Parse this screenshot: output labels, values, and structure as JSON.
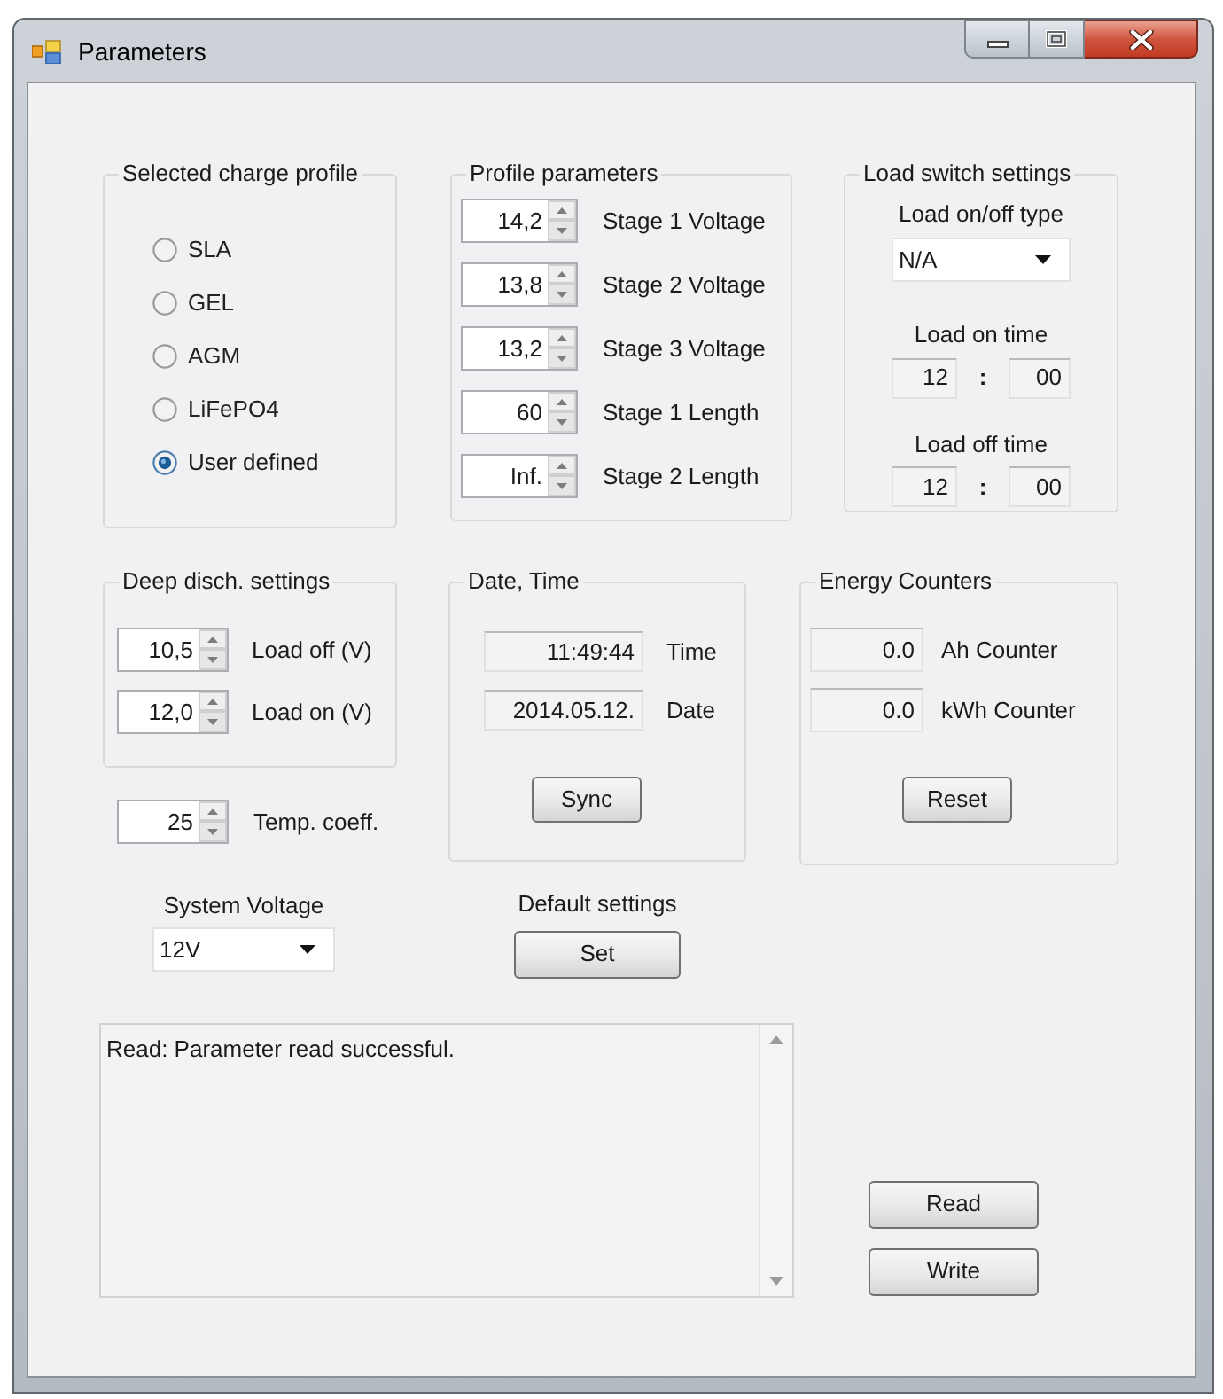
{
  "window": {
    "title": "Parameters"
  },
  "charge_profile": {
    "title": "Selected charge profile",
    "options": [
      {
        "label": "SLA",
        "selected": false
      },
      {
        "label": "GEL",
        "selected": false
      },
      {
        "label": "AGM",
        "selected": false
      },
      {
        "label": "LiFePO4",
        "selected": false
      },
      {
        "label": "User defined",
        "selected": true
      }
    ]
  },
  "profile_parameters": {
    "title": "Profile parameters",
    "rows": [
      {
        "value": "14,2",
        "label": "Stage 1 Voltage"
      },
      {
        "value": "13,8",
        "label": "Stage 2 Voltage"
      },
      {
        "value": "13,2",
        "label": "Stage 3 Voltage"
      },
      {
        "value": "60",
        "label": "Stage 1 Length"
      },
      {
        "value": "Inf.",
        "label": "Stage 2 Length"
      }
    ]
  },
  "load_switch": {
    "title": "Load switch settings",
    "type_label": "Load on/off type",
    "type_value": "N/A",
    "times": [
      {
        "label": "Load on time",
        "hours": "12",
        "separator": ":",
        "minutes": "00"
      },
      {
        "label": "Load off time",
        "hours": "12",
        "separator": ":",
        "minutes": "00"
      }
    ]
  },
  "deep_discharge": {
    "title": "Deep disch. settings",
    "rows": [
      {
        "value": "10,5",
        "label": "Load off (V)"
      },
      {
        "value": "12,0",
        "label": "Load on (V)"
      }
    ]
  },
  "temp_coeff": {
    "value": "25",
    "label": "Temp. coeff."
  },
  "system_voltage": {
    "label": "System Voltage",
    "value": "12V"
  },
  "date_time": {
    "title": "Date, Time",
    "fields": [
      {
        "value": "11:49:44",
        "label": "Time"
      },
      {
        "value": "2014.05.12.",
        "label": "Date"
      }
    ],
    "button": "Sync"
  },
  "default_settings": {
    "label": "Default settings",
    "button": "Set"
  },
  "energy_counters": {
    "title": "Energy Counters",
    "fields": [
      {
        "value": "0.0",
        "label": "Ah Counter"
      },
      {
        "value": "0.0",
        "label": "kWh Counter"
      }
    ],
    "button": "Reset"
  },
  "log": {
    "text": "Read: Parameter read successful."
  },
  "buttons": [
    "Read",
    "Write"
  ]
}
